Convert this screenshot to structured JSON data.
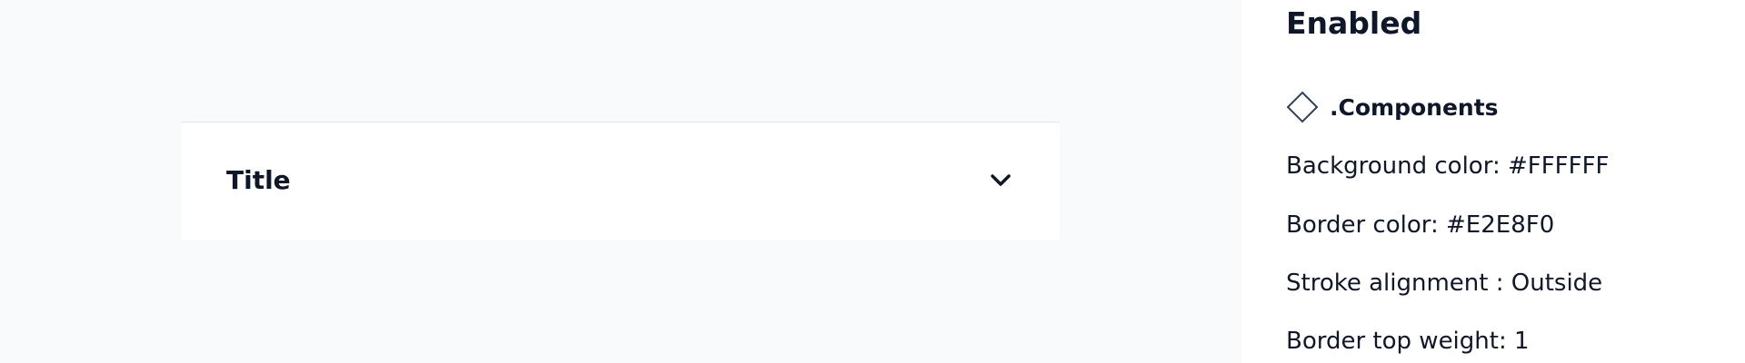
{
  "accordion": {
    "title": "Title",
    "chevron_icon": "chevron-down-icon",
    "background_color": "#FFFFFF",
    "border_color": "#E2E8F0"
  },
  "panel": {
    "heading": "Enabled",
    "component_icon": "diamond-icon",
    "component_label": ".Components",
    "properties": [
      "Background color: #FFFFFF",
      "Border color: #E2E8F0",
      "Stroke alignment : Outside",
      "Border top weight: 1"
    ]
  }
}
